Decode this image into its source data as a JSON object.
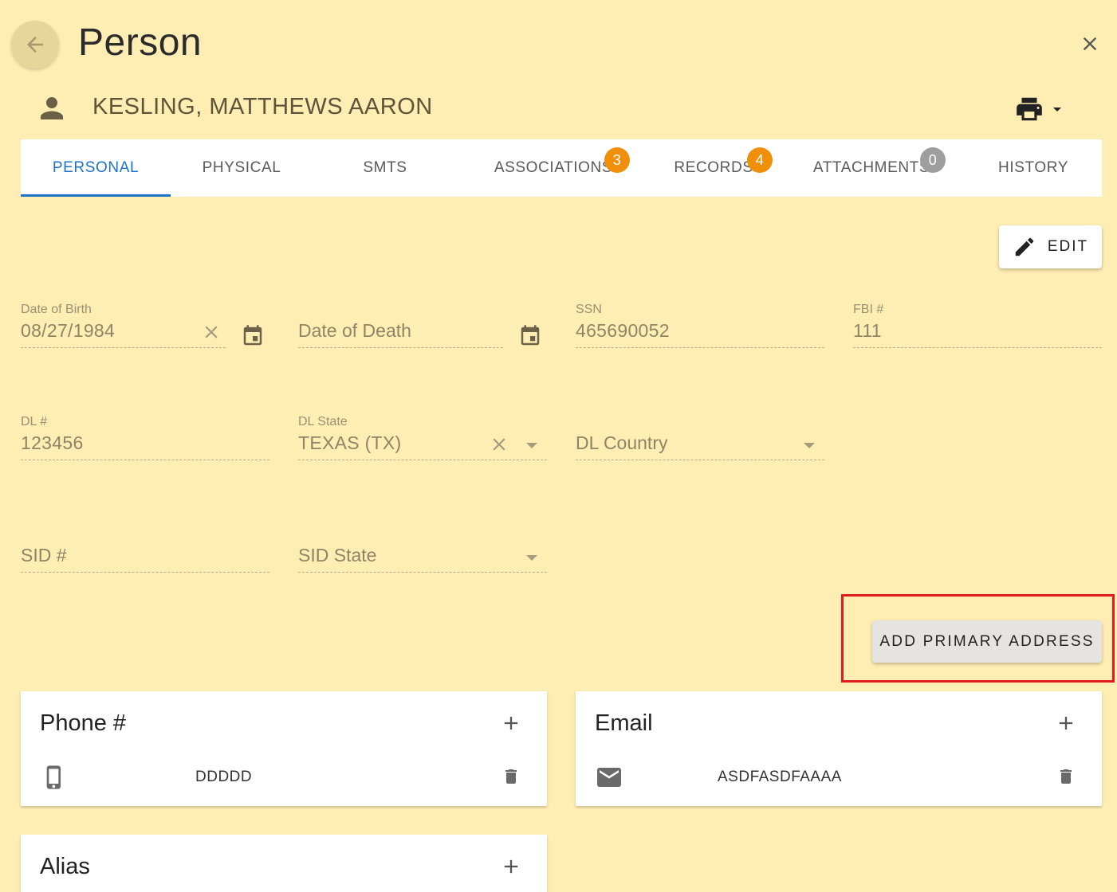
{
  "header": {
    "title": "Person",
    "person_name": "KESLING, MATTHEWS AARON"
  },
  "tabs": [
    {
      "label": "PERSONAL",
      "active": true
    },
    {
      "label": "PHYSICAL"
    },
    {
      "label": "SMTS"
    },
    {
      "label": "ASSOCIATIONS",
      "badge": "3",
      "badge_color": "#f0900a"
    },
    {
      "label": "RECORDS",
      "badge": "4",
      "badge_color": "#f0900a"
    },
    {
      "label": "ATTACHMENTS",
      "badge": "0",
      "badge_color": "#9e9e9e"
    },
    {
      "label": "HISTORY"
    }
  ],
  "edit_label": "EDIT",
  "fields": {
    "dob": {
      "label": "Date of Birth",
      "value": "08/27/1984"
    },
    "dod": {
      "placeholder": "Date of Death"
    },
    "ssn": {
      "label": "SSN",
      "value": "465690052"
    },
    "fbi": {
      "label": "FBI #",
      "value": "111"
    },
    "dl": {
      "label": "DL #",
      "value": "123456"
    },
    "dl_state": {
      "label": "DL State",
      "value": "TEXAS (TX)"
    },
    "dl_country": {
      "placeholder": "DL Country"
    },
    "sid": {
      "placeholder": "SID #"
    },
    "sid_state": {
      "placeholder": "SID State"
    }
  },
  "add_address_label": "ADD PRIMARY ADDRESS",
  "cards": {
    "phone": {
      "title": "Phone #",
      "item": "DDDDD"
    },
    "email": {
      "title": "Email",
      "item": "ASDFASDFAAAA"
    },
    "alias": {
      "title": "Alias"
    }
  },
  "colors": {
    "background": "#ffeeb3",
    "accent": "#1f72c9",
    "badge_orange": "#f0900a",
    "badge_gray": "#9e9e9e",
    "highlight": "#e01b1b"
  }
}
